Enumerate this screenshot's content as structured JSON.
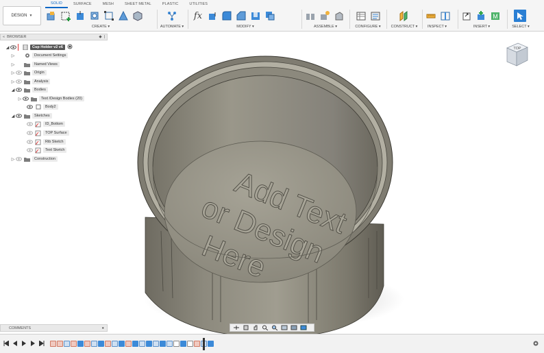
{
  "toolbar": {
    "workspace_label": "DESIGN",
    "tabs": [
      "SOLID",
      "SURFACE",
      "MESH",
      "SHEET METAL",
      "PLASTIC",
      "UTILITIES"
    ],
    "active_tab": "SOLID",
    "groups": {
      "create": "CREATE ▾",
      "automate": "AUTOMATE ▾",
      "modify": "MODIFY ▾",
      "assemble": "ASSEMBLE ▾",
      "configure": "CONFIGURE ▾",
      "construct": "CONSTRUCT ▾",
      "inspect": "INSPECT ▾",
      "insert": "INSERT ▾",
      "select": "SELECT ▾"
    }
  },
  "browser": {
    "title": "BROWSER",
    "root": "Cup Holder v2 v6",
    "items": [
      {
        "label": "Document Settings",
        "icon": "gear-icon"
      },
      {
        "label": "Named Views",
        "icon": "folder-icon"
      },
      {
        "label": "Origin",
        "icon": "folder-icon"
      },
      {
        "label": "Analysis",
        "icon": "folder-icon"
      },
      {
        "label": "Bodies",
        "icon": "folder-icon"
      },
      {
        "label": "Text /Design Bodies (20)",
        "icon": "folder-icon"
      },
      {
        "label": "Body2",
        "icon": "body-icon"
      },
      {
        "label": "Sketches",
        "icon": "folder-icon"
      },
      {
        "label": "ID_Bottom",
        "icon": "sketch-icon"
      },
      {
        "label": "TOP Surface",
        "icon": "sketch-icon"
      },
      {
        "label": "Rib Sketch",
        "icon": "sketch-icon"
      },
      {
        "label": "Text Sketch",
        "icon": "sketch-icon"
      },
      {
        "label": "Construction",
        "icon": "folder-icon"
      }
    ]
  },
  "comments": {
    "title": "COMMENTS"
  },
  "viewcube": {
    "face_label": "TOP"
  },
  "model": {
    "engraved_text": [
      "Add Text",
      "or Design",
      "Here"
    ]
  },
  "colors": {
    "accent": "#0a67c6",
    "model_body": "#8a877b",
    "model_light": "#a9a698"
  }
}
